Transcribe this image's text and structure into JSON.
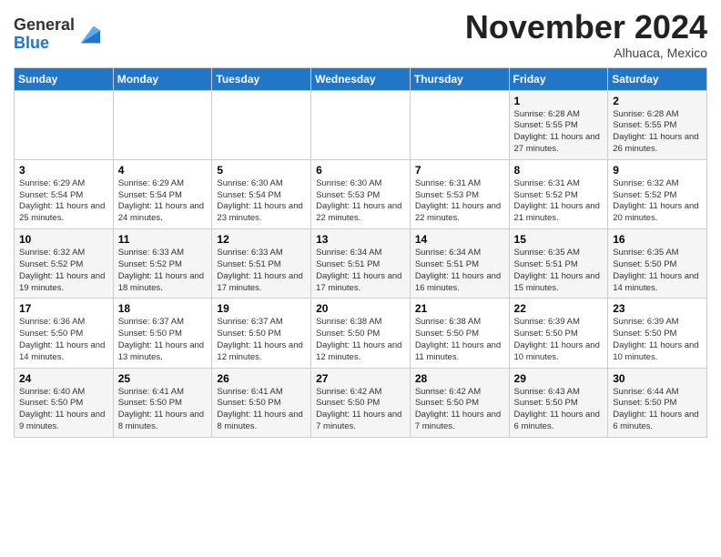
{
  "header": {
    "logo_general": "General",
    "logo_blue": "Blue",
    "month_title": "November 2024",
    "location": "Alhuaca, Mexico"
  },
  "days_of_week": [
    "Sunday",
    "Monday",
    "Tuesday",
    "Wednesday",
    "Thursday",
    "Friday",
    "Saturday"
  ],
  "weeks": [
    [
      {
        "day": "",
        "info": ""
      },
      {
        "day": "",
        "info": ""
      },
      {
        "day": "",
        "info": ""
      },
      {
        "day": "",
        "info": ""
      },
      {
        "day": "",
        "info": ""
      },
      {
        "day": "1",
        "info": "Sunrise: 6:28 AM\nSunset: 5:55 PM\nDaylight: 11 hours and 27 minutes."
      },
      {
        "day": "2",
        "info": "Sunrise: 6:28 AM\nSunset: 5:55 PM\nDaylight: 11 hours and 26 minutes."
      }
    ],
    [
      {
        "day": "3",
        "info": "Sunrise: 6:29 AM\nSunset: 5:54 PM\nDaylight: 11 hours and 25 minutes."
      },
      {
        "day": "4",
        "info": "Sunrise: 6:29 AM\nSunset: 5:54 PM\nDaylight: 11 hours and 24 minutes."
      },
      {
        "day": "5",
        "info": "Sunrise: 6:30 AM\nSunset: 5:54 PM\nDaylight: 11 hours and 23 minutes."
      },
      {
        "day": "6",
        "info": "Sunrise: 6:30 AM\nSunset: 5:53 PM\nDaylight: 11 hours and 22 minutes."
      },
      {
        "day": "7",
        "info": "Sunrise: 6:31 AM\nSunset: 5:53 PM\nDaylight: 11 hours and 22 minutes."
      },
      {
        "day": "8",
        "info": "Sunrise: 6:31 AM\nSunset: 5:52 PM\nDaylight: 11 hours and 21 minutes."
      },
      {
        "day": "9",
        "info": "Sunrise: 6:32 AM\nSunset: 5:52 PM\nDaylight: 11 hours and 20 minutes."
      }
    ],
    [
      {
        "day": "10",
        "info": "Sunrise: 6:32 AM\nSunset: 5:52 PM\nDaylight: 11 hours and 19 minutes."
      },
      {
        "day": "11",
        "info": "Sunrise: 6:33 AM\nSunset: 5:52 PM\nDaylight: 11 hours and 18 minutes."
      },
      {
        "day": "12",
        "info": "Sunrise: 6:33 AM\nSunset: 5:51 PM\nDaylight: 11 hours and 17 minutes."
      },
      {
        "day": "13",
        "info": "Sunrise: 6:34 AM\nSunset: 5:51 PM\nDaylight: 11 hours and 17 minutes."
      },
      {
        "day": "14",
        "info": "Sunrise: 6:34 AM\nSunset: 5:51 PM\nDaylight: 11 hours and 16 minutes."
      },
      {
        "day": "15",
        "info": "Sunrise: 6:35 AM\nSunset: 5:51 PM\nDaylight: 11 hours and 15 minutes."
      },
      {
        "day": "16",
        "info": "Sunrise: 6:35 AM\nSunset: 5:50 PM\nDaylight: 11 hours and 14 minutes."
      }
    ],
    [
      {
        "day": "17",
        "info": "Sunrise: 6:36 AM\nSunset: 5:50 PM\nDaylight: 11 hours and 14 minutes."
      },
      {
        "day": "18",
        "info": "Sunrise: 6:37 AM\nSunset: 5:50 PM\nDaylight: 11 hours and 13 minutes."
      },
      {
        "day": "19",
        "info": "Sunrise: 6:37 AM\nSunset: 5:50 PM\nDaylight: 11 hours and 12 minutes."
      },
      {
        "day": "20",
        "info": "Sunrise: 6:38 AM\nSunset: 5:50 PM\nDaylight: 11 hours and 12 minutes."
      },
      {
        "day": "21",
        "info": "Sunrise: 6:38 AM\nSunset: 5:50 PM\nDaylight: 11 hours and 11 minutes."
      },
      {
        "day": "22",
        "info": "Sunrise: 6:39 AM\nSunset: 5:50 PM\nDaylight: 11 hours and 10 minutes."
      },
      {
        "day": "23",
        "info": "Sunrise: 6:39 AM\nSunset: 5:50 PM\nDaylight: 11 hours and 10 minutes."
      }
    ],
    [
      {
        "day": "24",
        "info": "Sunrise: 6:40 AM\nSunset: 5:50 PM\nDaylight: 11 hours and 9 minutes."
      },
      {
        "day": "25",
        "info": "Sunrise: 6:41 AM\nSunset: 5:50 PM\nDaylight: 11 hours and 8 minutes."
      },
      {
        "day": "26",
        "info": "Sunrise: 6:41 AM\nSunset: 5:50 PM\nDaylight: 11 hours and 8 minutes."
      },
      {
        "day": "27",
        "info": "Sunrise: 6:42 AM\nSunset: 5:50 PM\nDaylight: 11 hours and 7 minutes."
      },
      {
        "day": "28",
        "info": "Sunrise: 6:42 AM\nSunset: 5:50 PM\nDaylight: 11 hours and 7 minutes."
      },
      {
        "day": "29",
        "info": "Sunrise: 6:43 AM\nSunset: 5:50 PM\nDaylight: 11 hours and 6 minutes."
      },
      {
        "day": "30",
        "info": "Sunrise: 6:44 AM\nSunset: 5:50 PM\nDaylight: 11 hours and 6 minutes."
      }
    ]
  ]
}
